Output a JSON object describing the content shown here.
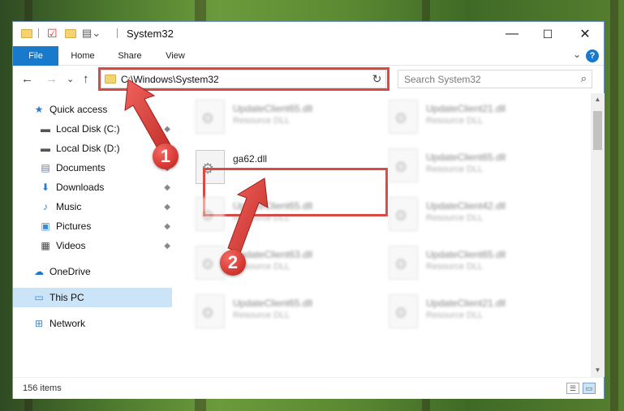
{
  "window": {
    "title": "System32",
    "minimize_glyph": "—",
    "maximize_glyph": "☐",
    "close_glyph": "✕"
  },
  "ribbon": {
    "tabs": [
      "File",
      "Home",
      "Share",
      "View"
    ],
    "expand_glyph": "⌄",
    "help_glyph": "?"
  },
  "nav": {
    "back_glyph": "←",
    "forward_glyph": "→",
    "recent_glyph": "⌄",
    "up_glyph": "↑",
    "address_path": "C:\\Windows\\System32",
    "address_dropdown_glyph": "⌄",
    "refresh_glyph": "↻",
    "search_placeholder": "Search System32",
    "search_glyph": "⌕"
  },
  "sidebar": {
    "items": [
      {
        "label": "Quick access",
        "icon": "star-icon",
        "glyph": "★",
        "color": "#2e7ad1",
        "pinned": false
      },
      {
        "label": "Local Disk (C:)",
        "icon": "drive-icon",
        "glyph": "▬",
        "color": "#555555",
        "pinned": true
      },
      {
        "label": "Local Disk (D:)",
        "icon": "drive-icon",
        "glyph": "▬",
        "color": "#555555",
        "pinned": true
      },
      {
        "label": "Documents",
        "icon": "documents-icon",
        "glyph": "▤",
        "color": "#6b7a8c",
        "pinned": true
      },
      {
        "label": "Downloads",
        "icon": "downloads-icon",
        "glyph": "⬇",
        "color": "#2e7ad1",
        "pinned": true
      },
      {
        "label": "Music",
        "icon": "music-icon",
        "glyph": "♪",
        "color": "#2e7ad1",
        "pinned": true
      },
      {
        "label": "Pictures",
        "icon": "pictures-icon",
        "glyph": "▣",
        "color": "#3a8ad8",
        "pinned": true
      },
      {
        "label": "Videos",
        "icon": "videos-icon",
        "glyph": "▦",
        "color": "#444444",
        "pinned": true
      },
      {
        "label": "OneDrive",
        "icon": "cloud-icon",
        "glyph": "☁",
        "color": "#1979ca",
        "pinned": false
      },
      {
        "label": "This PC",
        "icon": "monitor-icon",
        "glyph": "▭",
        "color": "#3a8ad8",
        "pinned": false,
        "selected": true
      },
      {
        "label": "Network",
        "icon": "network-icon",
        "glyph": "⊞",
        "color": "#3a8ad8",
        "pinned": false
      }
    ],
    "pin_glyph": "📌"
  },
  "files": {
    "highlighted": {
      "name": "ga62.dll",
      "type": ""
    },
    "left_column": [
      {
        "name": "UpdateClient65.dll",
        "type": "Resource DLL"
      },
      {
        "name": "UpdateClient65.dll",
        "type": "Resource DLL"
      },
      {
        "name": "UpdateClient63.dll",
        "type": "Resource DLL"
      },
      {
        "name": "UpdateClient65.dll",
        "type": "Resource DLL"
      }
    ],
    "right_column": [
      {
        "name": "UpdateClient21.dll",
        "type": "Resource DLL"
      },
      {
        "name": "UpdateClient65.dll",
        "type": "Resource DLL"
      },
      {
        "name": "UpdateClient42.dll",
        "type": "Resource DLL"
      },
      {
        "name": "UpdateClient65.dll",
        "type": "Resource DLL"
      },
      {
        "name": "UpdateClient21.dll",
        "type": "Resource DLL"
      }
    ],
    "gear_glyph": "⚙"
  },
  "status": {
    "item_count": "156 items",
    "details_view_glyph": "☰",
    "tiles_view_glyph": "▭"
  },
  "annotations": {
    "step1": "1",
    "step2": "2",
    "color": "#d94a45"
  }
}
